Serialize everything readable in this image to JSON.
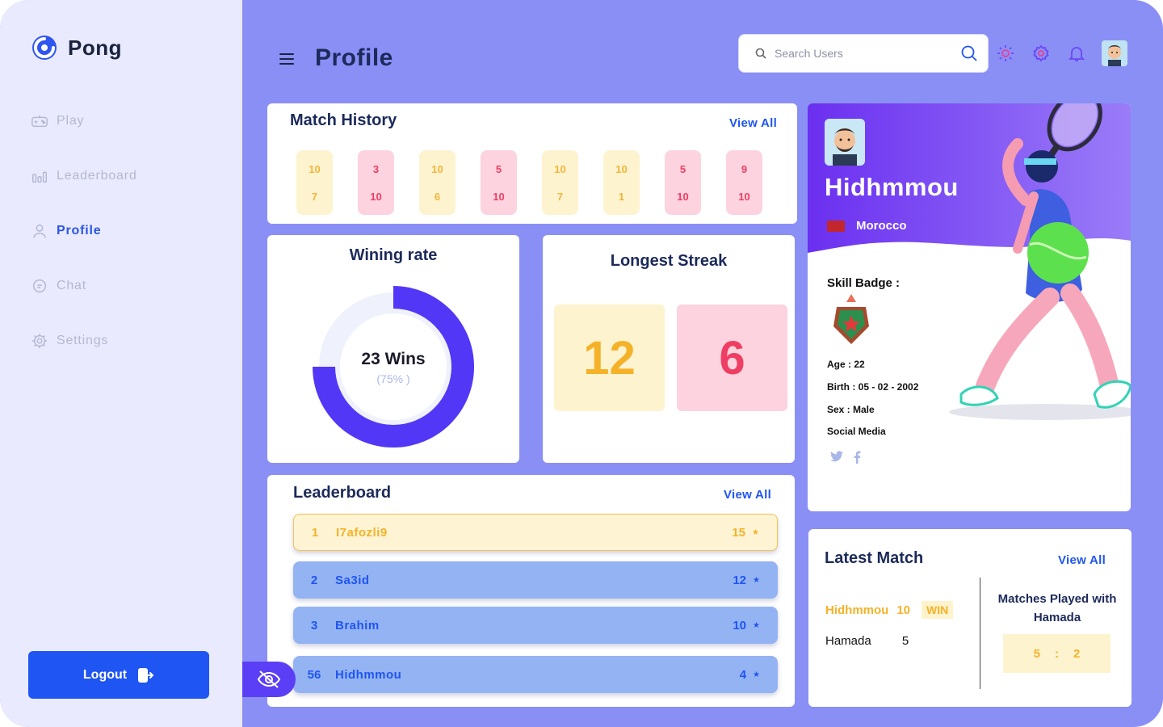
{
  "app": {
    "name": "Pong"
  },
  "sidebar": {
    "items": [
      {
        "label": "Play",
        "icon": "gamepad-icon",
        "active": false
      },
      {
        "label": "Leaderboard",
        "icon": "bar-chart-icon",
        "active": false
      },
      {
        "label": "Profile",
        "icon": "user-icon",
        "active": true
      },
      {
        "label": "Chat",
        "icon": "chat-icon",
        "active": false
      },
      {
        "label": "Settings",
        "icon": "gear-icon",
        "active": false
      }
    ],
    "logout_label": "Logout"
  },
  "header": {
    "title": "Profile",
    "search_placeholder": "Search Users"
  },
  "match_history": {
    "title": "Match History",
    "view_all": "View All",
    "scores": [
      {
        "top": "10",
        "bottom": "7",
        "result": "win"
      },
      {
        "top": "3",
        "bottom": "10",
        "result": "loss"
      },
      {
        "top": "10",
        "bottom": "6",
        "result": "win"
      },
      {
        "top": "5",
        "bottom": "10",
        "result": "loss"
      },
      {
        "top": "10",
        "bottom": "7",
        "result": "win"
      },
      {
        "top": "10",
        "bottom": "1",
        "result": "win"
      },
      {
        "top": "5",
        "bottom": "10",
        "result": "loss"
      },
      {
        "top": "9",
        "bottom": "10",
        "result": "loss"
      }
    ]
  },
  "winning_rate": {
    "title": "Wining rate",
    "wins_label": "23 Wins",
    "percent_label": "(75% )",
    "fraction": 0.75
  },
  "longest_streak": {
    "title": "Longest Streak",
    "wins": "12",
    "losses": "6"
  },
  "leaderboard": {
    "title": "Leaderboard",
    "view_all": "View All",
    "rows": [
      {
        "rank": "1",
        "name": "I7afozli9",
        "points": "15"
      },
      {
        "rank": "2",
        "name": "Sa3id",
        "points": "12"
      },
      {
        "rank": "3",
        "name": "Brahim",
        "points": "10"
      },
      {
        "rank": "56",
        "name": "Hidhmmou",
        "points": "4"
      }
    ]
  },
  "profile": {
    "name": "Hidhmmou",
    "country": "Morocco",
    "skill_badge_label": "Skill Badge :",
    "age": "Age : 22",
    "birth": "Birth : 05 - 02 - 2002",
    "sex": "Sex : Male",
    "social_label": "Social Media"
  },
  "latest_match": {
    "title": "Latest Match",
    "view_all": "View All",
    "player1": "Hidhmmou",
    "score1": "10",
    "result": "WIN",
    "player2": "Hamada",
    "score2": "5",
    "played_with_title": "Matches Played with Hamada",
    "record_left": "5",
    "record_sep": ":",
    "record_right": "2"
  },
  "colors": {
    "background": "#8a8ff6",
    "sidebar": "#e9eafd",
    "accent": "#1f55f2",
    "donut": "#5237f6",
    "win": "#f5b228",
    "loss": "#ef3e63"
  }
}
